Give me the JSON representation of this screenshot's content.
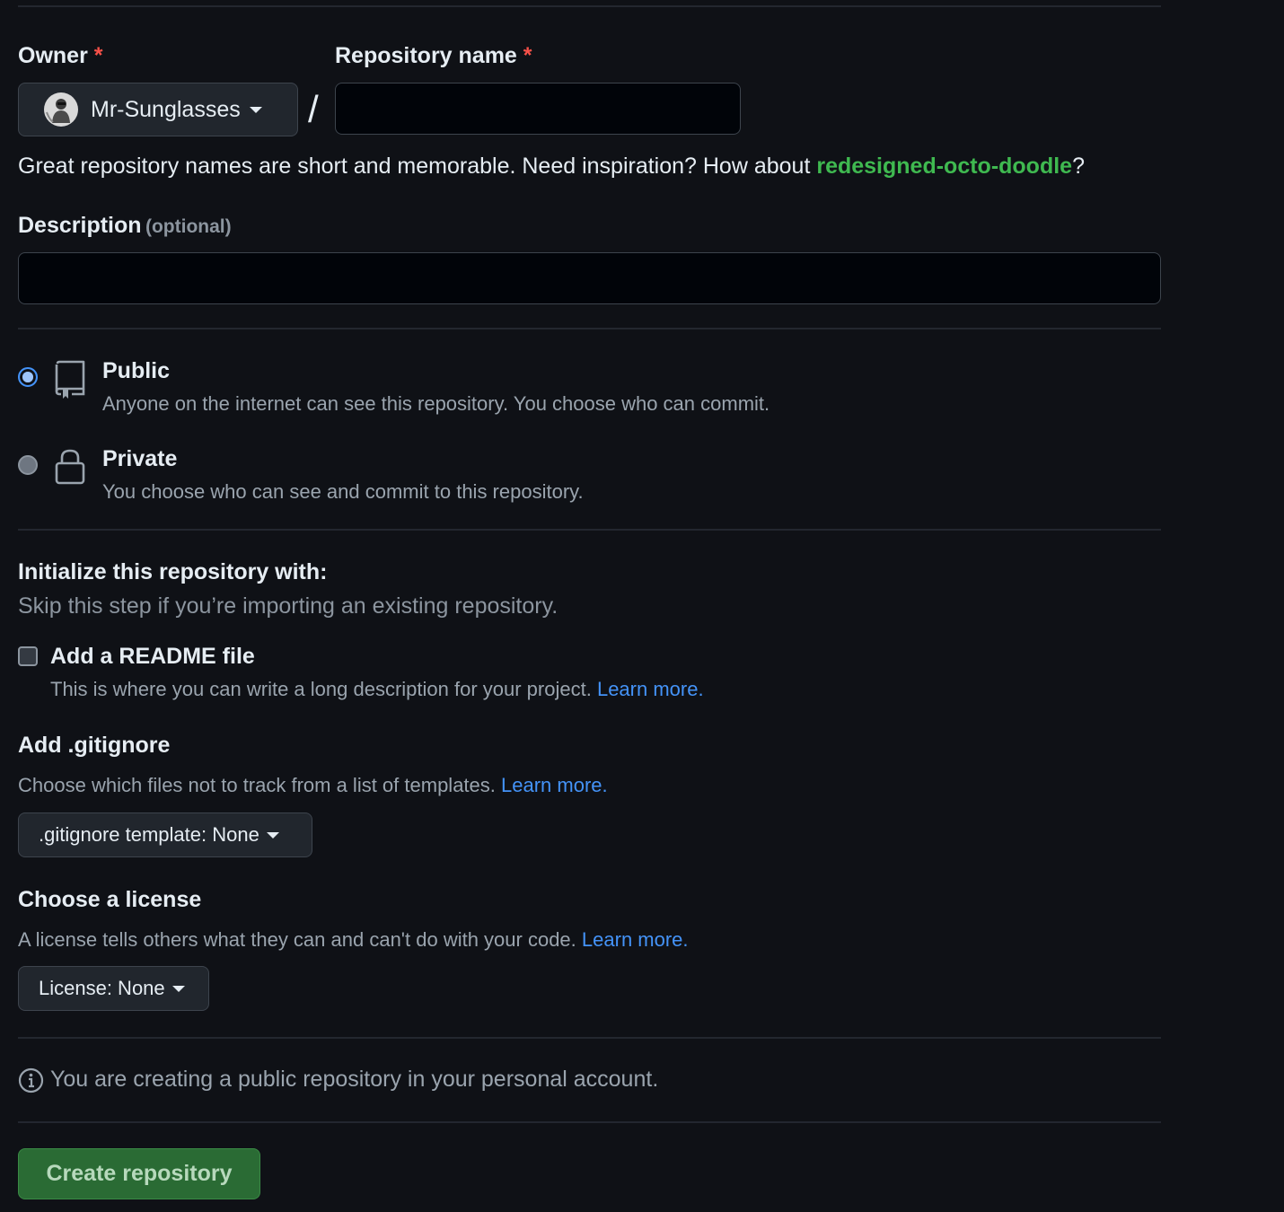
{
  "owner": {
    "label": "Owner",
    "required_mark": "*",
    "selected": "Mr-Sunglasses"
  },
  "repo_name": {
    "label": "Repository name",
    "required_mark": "*",
    "value": "",
    "separator": "/"
  },
  "suggestion": {
    "text_before": "Great repository names are short and memorable. Need inspiration? How about ",
    "name": "redesigned-octo-doodle",
    "text_after": "?"
  },
  "description": {
    "label": "Description",
    "optional": "(optional)",
    "value": ""
  },
  "visibility": {
    "options": [
      {
        "title": "Public",
        "description": "Anyone on the internet can see this repository. You choose who can commit.",
        "checked": true
      },
      {
        "title": "Private",
        "description": "You choose who can see and commit to this repository.",
        "checked": false
      }
    ]
  },
  "initialize": {
    "heading": "Initialize this repository with:",
    "subtitle": "Skip this step if you’re importing an existing repository.",
    "readme": {
      "label": "Add a README file",
      "description": "This is where you can write a long description for your project. ",
      "link": "Learn more.",
      "checked": false
    }
  },
  "gitignore": {
    "heading": "Add .gitignore",
    "description": "Choose which files not to track from a list of templates. ",
    "link": "Learn more.",
    "button": ".gitignore template: None"
  },
  "license": {
    "heading": "Choose a license",
    "description": "A license tells others what they can and can't do with your code. ",
    "link": "Learn more.",
    "button": "License: None"
  },
  "notice": {
    "icon": "info-icon",
    "text": "You are creating a public repository in your personal account."
  },
  "submit": {
    "label": "Create repository"
  },
  "colors": {
    "background": "#0f1116",
    "link": "#4493f8",
    "suggestion": "#3fb950",
    "primary_button": "#2a6b34",
    "required": "#f85149"
  }
}
